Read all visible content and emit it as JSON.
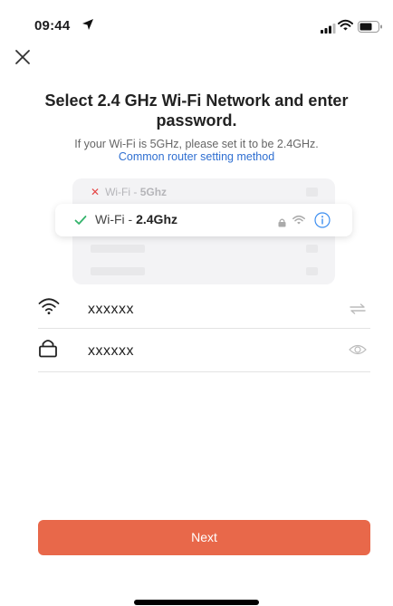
{
  "status_bar": {
    "time": "09:44",
    "icons": [
      "location-arrow-icon",
      "cellular-signal-icon",
      "wifi-icon",
      "battery-icon"
    ]
  },
  "header": {
    "close_icon": "close-icon"
  },
  "main": {
    "title": "Select 2.4 GHz Wi-Fi Network and enter password.",
    "subtitle": "If your Wi-Fi is 5GHz, please set it to be 2.4GHz.",
    "router_link": "Common router setting method"
  },
  "illustration": {
    "row_5g_prefix": "Wi-Fi - ",
    "row_5g_band": "5Ghz",
    "row_24g_prefix": "Wi-Fi - ",
    "row_24g_band": "2.4Ghz",
    "colors": {
      "cross": "#e54646",
      "check": "#33b36b",
      "info": "#3c8ef0"
    }
  },
  "form": {
    "ssid_value": "xxxxxx",
    "password_value": "xxxxxx",
    "ssid_icon": "wifi-icon",
    "password_icon": "lock-icon",
    "ssid_action_icon": "switch-arrows-icon",
    "password_action_icon": "eye-icon"
  },
  "actions": {
    "next_label": "Next",
    "accent": "#e8684a"
  }
}
